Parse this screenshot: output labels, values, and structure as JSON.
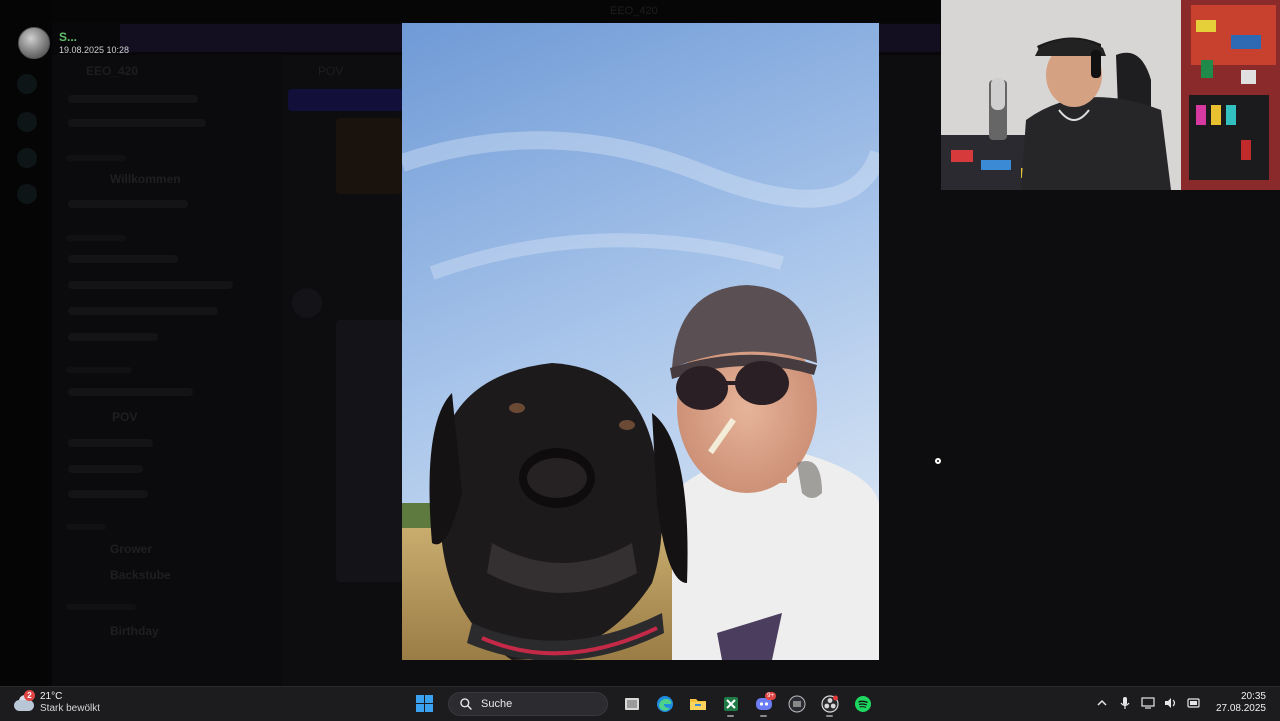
{
  "viewer": {
    "poster_name": "S...",
    "poster_time": "19.08.2025 10:28",
    "window_title": "EEO_420"
  },
  "background": {
    "server_name": "EEO_420",
    "channel_header": "POV",
    "channels_bold": [
      "Willkommen",
      "POV",
      "Grower",
      "Backstube",
      "Birthday"
    ]
  },
  "taskbar": {
    "weather": {
      "temp": "21°C",
      "desc": "Stark bewölkt",
      "badge": "2",
      "icon": "cloud-icon"
    },
    "search_label": "Suche",
    "apps": [
      "windows-start-icon",
      "task-view-icon",
      "edge-icon",
      "file-explorer-icon",
      "excel-icon",
      "discord-icon",
      "app-icon",
      "obs-icon",
      "spotify-icon"
    ],
    "discord_badge": "9+",
    "clock": {
      "time": "20:35",
      "date": "27.08.2025"
    }
  },
  "colors": {
    "accent_green": "#5fbf6a",
    "taskbar_bg": "#1c1c1f",
    "win_blue": "#3aa0f0",
    "spotify_green": "#1ed760"
  }
}
